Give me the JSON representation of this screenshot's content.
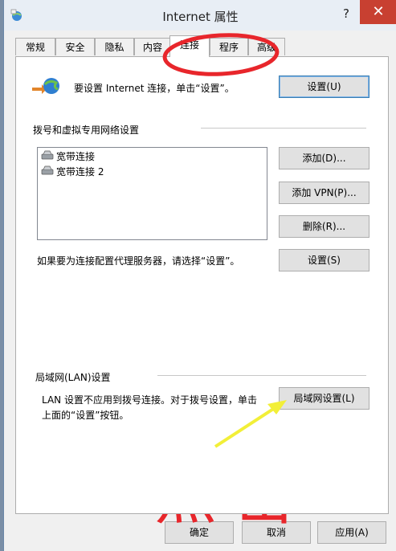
{
  "window": {
    "title": "Internet 属性",
    "help_label": "?",
    "close_label": "✕"
  },
  "tabs": [
    {
      "label": "常规"
    },
    {
      "label": "安全"
    },
    {
      "label": "隐私"
    },
    {
      "label": "内容"
    },
    {
      "label": "连接",
      "active": true
    },
    {
      "label": "程序"
    },
    {
      "label": "高级"
    }
  ],
  "setup": {
    "text": "要设置 Internet 连接，单击“设置”。",
    "button": "设置(U)"
  },
  "dialup": {
    "heading": "拨号和虚拟专用网络设置",
    "connections": [
      "宽带连接",
      "宽带连接 2"
    ],
    "add_button": "添加(D)...",
    "add_vpn_button": "添加 VPN(P)...",
    "remove_button": "删除(R)...",
    "proxy_text": "如果要为连接配置代理服务器，请选择“设置”。",
    "settings_button": "设置(S)"
  },
  "lan": {
    "heading": "局域网(LAN)设置",
    "text_line1": "LAN 设置不应用到拨号连接。对于拨号设置，单击",
    "text_line2": "上面的“设置”按钮。",
    "button": "局域网设置(L)"
  },
  "footer": {
    "ok": "确定",
    "cancel": "取消",
    "apply": "应用(A)"
  },
  "annotation": {
    "text": "点击",
    "color": "#e8262b"
  }
}
